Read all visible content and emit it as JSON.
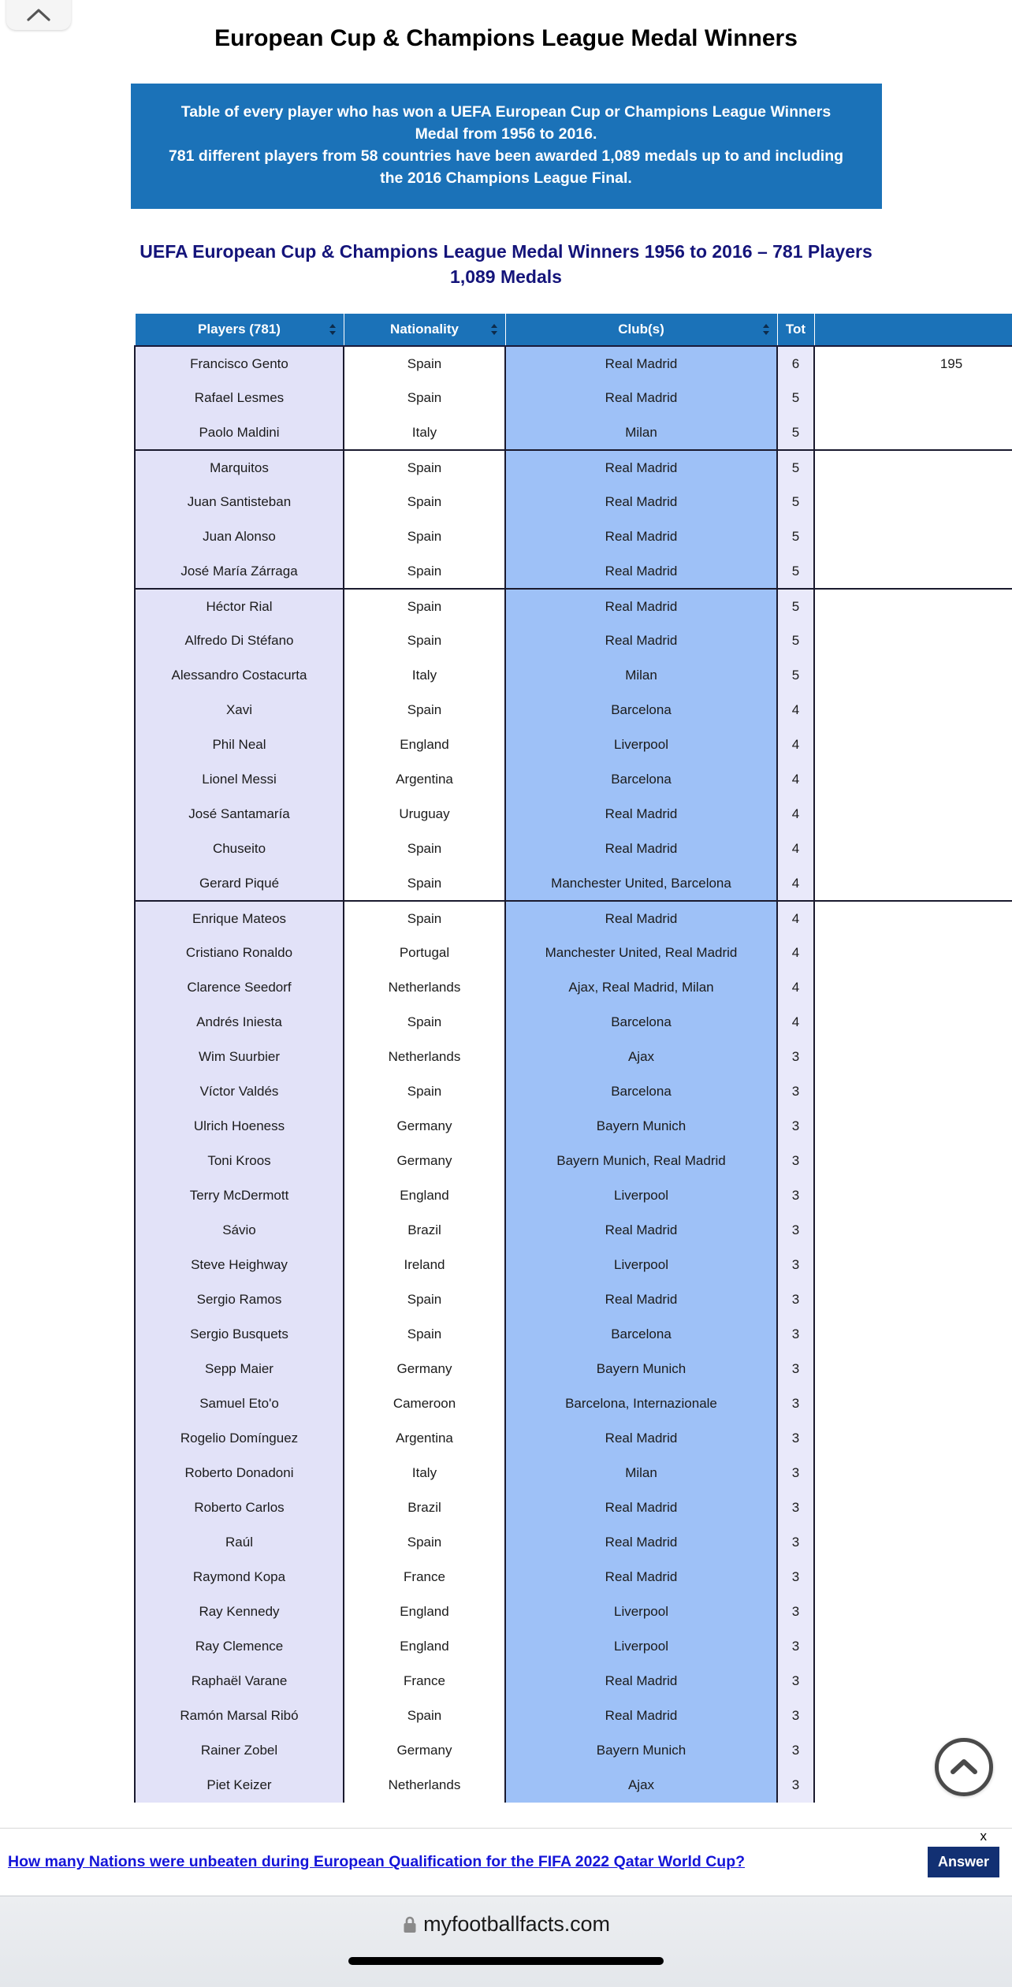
{
  "page": {
    "title": "European Cup & Champions League Medal Winners",
    "info_lines": [
      "Table of every player who has won a UEFA European Cup or Champions League Winners Medal from 1956 to 2016.",
      "781 different players from 58 countries have been awarded 1,089 medals up to and including the 2016 Champions League Final."
    ],
    "subtitle": "UEFA European Cup & Champions League Medal Winners 1956 to 2016 – 781 Players 1,089 Medals"
  },
  "top_chip": {
    "icon": "chevron-up-icon"
  },
  "scroll_top_button": {
    "icon": "circle-chevron-up-icon"
  },
  "table": {
    "columns": [
      {
        "label": "Players (781)",
        "sortable": true
      },
      {
        "label": "Nationality",
        "sortable": true
      },
      {
        "label": "Club(s)",
        "sortable": true
      },
      {
        "label": "Tot",
        "sortable": false
      },
      {
        "label": "",
        "sortable": false
      }
    ],
    "rows": [
      {
        "player": "Francisco Gento",
        "nationality": "Spain",
        "clubs": "Real Madrid",
        "tot": "6",
        "years": "195",
        "group_start": true
      },
      {
        "player": "Rafael Lesmes",
        "nationality": "Spain",
        "clubs": "Real Madrid",
        "tot": "5",
        "years": ""
      },
      {
        "player": "Paolo Maldini",
        "nationality": "Italy",
        "clubs": "Milan",
        "tot": "5",
        "years": "",
        "group_end": true
      },
      {
        "player": "Marquitos",
        "nationality": "Spain",
        "clubs": "Real Madrid",
        "tot": "5",
        "years": "",
        "group_start": true
      },
      {
        "player": "Juan Santisteban",
        "nationality": "Spain",
        "clubs": "Real Madrid",
        "tot": "5",
        "years": ""
      },
      {
        "player": "Juan Alonso",
        "nationality": "Spain",
        "clubs": "Real Madrid",
        "tot": "5",
        "years": ""
      },
      {
        "player": "José María Zárraga",
        "nationality": "Spain",
        "clubs": "Real Madrid",
        "tot": "5",
        "years": "",
        "group_end": true
      },
      {
        "player": "Héctor Rial",
        "nationality": "Spain",
        "clubs": "Real Madrid",
        "tot": "5",
        "years": "",
        "group_start": true
      },
      {
        "player": "Alfredo Di Stéfano",
        "nationality": "Spain",
        "clubs": "Real Madrid",
        "tot": "5",
        "years": ""
      },
      {
        "player": "Alessandro Costacurta",
        "nationality": "Italy",
        "clubs": "Milan",
        "tot": "5",
        "years": ""
      },
      {
        "player": "Xavi",
        "nationality": "Spain",
        "clubs": "Barcelona",
        "tot": "4",
        "years": ""
      },
      {
        "player": "Phil Neal",
        "nationality": "England",
        "clubs": "Liverpool",
        "tot": "4",
        "years": ""
      },
      {
        "player": "Lionel Messi",
        "nationality": "Argentina",
        "clubs": "Barcelona",
        "tot": "4",
        "years": ""
      },
      {
        "player": "José Santamaría",
        "nationality": "Uruguay",
        "clubs": "Real Madrid",
        "tot": "4",
        "years": ""
      },
      {
        "player": "Chuseito",
        "nationality": "Spain",
        "clubs": "Real Madrid",
        "tot": "4",
        "years": ""
      },
      {
        "player": "Gerard Piqué",
        "nationality": "Spain",
        "clubs": "Manchester United, Barcelona",
        "tot": "4",
        "years": "",
        "group_end": true
      },
      {
        "player": "Enrique Mateos",
        "nationality": "Spain",
        "clubs": "Real Madrid",
        "tot": "4",
        "years": "",
        "group_start": true
      },
      {
        "player": "Cristiano Ronaldo",
        "nationality": "Portugal",
        "clubs": "Manchester United, Real Madrid",
        "tot": "4",
        "years": ""
      },
      {
        "player": "Clarence Seedorf",
        "nationality": "Netherlands",
        "clubs": "Ajax, Real Madrid, Milan",
        "tot": "4",
        "years": ""
      },
      {
        "player": "Andrés Iniesta",
        "nationality": "Spain",
        "clubs": "Barcelona",
        "tot": "4",
        "years": ""
      },
      {
        "player": "Wim Suurbier",
        "nationality": "Netherlands",
        "clubs": "Ajax",
        "tot": "3",
        "years": ""
      },
      {
        "player": "Víctor Valdés",
        "nationality": "Spain",
        "clubs": "Barcelona",
        "tot": "3",
        "years": ""
      },
      {
        "player": "Ulrich Hoeness",
        "nationality": "Germany",
        "clubs": "Bayern Munich",
        "tot": "3",
        "years": ""
      },
      {
        "player": "Toni Kroos",
        "nationality": "Germany",
        "clubs": "Bayern Munich, Real Madrid",
        "tot": "3",
        "years": ""
      },
      {
        "player": "Terry McDermott",
        "nationality": "England",
        "clubs": "Liverpool",
        "tot": "3",
        "years": ""
      },
      {
        "player": "Sávio",
        "nationality": "Brazil",
        "clubs": "Real Madrid",
        "tot": "3",
        "years": ""
      },
      {
        "player": "Steve Heighway",
        "nationality": "Ireland",
        "clubs": "Liverpool",
        "tot": "3",
        "years": ""
      },
      {
        "player": "Sergio Ramos",
        "nationality": "Spain",
        "clubs": "Real Madrid",
        "tot": "3",
        "years": ""
      },
      {
        "player": "Sergio Busquets",
        "nationality": "Spain",
        "clubs": "Barcelona",
        "tot": "3",
        "years": ""
      },
      {
        "player": "Sepp Maier",
        "nationality": "Germany",
        "clubs": "Bayern Munich",
        "tot": "3",
        "years": ""
      },
      {
        "player": "Samuel Eto'o",
        "nationality": "Cameroon",
        "clubs": "Barcelona, Internazionale",
        "tot": "3",
        "years": ""
      },
      {
        "player": "Rogelio Domínguez",
        "nationality": "Argentina",
        "clubs": "Real Madrid",
        "tot": "3",
        "years": ""
      },
      {
        "player": "Roberto Donadoni",
        "nationality": "Italy",
        "clubs": "Milan",
        "tot": "3",
        "years": ""
      },
      {
        "player": "Roberto Carlos",
        "nationality": "Brazil",
        "clubs": "Real Madrid",
        "tot": "3",
        "years": ""
      },
      {
        "player": "Raúl",
        "nationality": "Spain",
        "clubs": "Real Madrid",
        "tot": "3",
        "years": ""
      },
      {
        "player": "Raymond Kopa",
        "nationality": "France",
        "clubs": "Real Madrid",
        "tot": "3",
        "years": ""
      },
      {
        "player": "Ray Kennedy",
        "nationality": "England",
        "clubs": "Liverpool",
        "tot": "3",
        "years": ""
      },
      {
        "player": "Ray Clemence",
        "nationality": "England",
        "clubs": "Liverpool",
        "tot": "3",
        "years": ""
      },
      {
        "player": "Raphaël Varane",
        "nationality": "France",
        "clubs": "Real Madrid",
        "tot": "3",
        "years": ""
      },
      {
        "player": "Ramón Marsal Ribó",
        "nationality": "Spain",
        "clubs": "Real Madrid",
        "tot": "3",
        "years": ""
      },
      {
        "player": "Rainer Zobel",
        "nationality": "Germany",
        "clubs": "Bayern Munich",
        "tot": "3",
        "years": ""
      },
      {
        "player": "Piet Keizer",
        "nationality": "Netherlands",
        "clubs": "Ajax",
        "tot": "3",
        "years": ""
      }
    ]
  },
  "ad_banner": {
    "question": "How many Nations were unbeaten during European Qualification for the FIFA 2022 Qatar World Cup?",
    "answer_label": "Answer",
    "close_label": "x"
  },
  "browser": {
    "url": "myfootballfacts.com",
    "lock_icon": "lock-icon"
  },
  "colors": {
    "header_blue": "#1b72b8",
    "subtitle_navy": "#14147a",
    "club_cell": "#9ec1f7",
    "player_cell": "#e2e2f8",
    "ad_link": "#1414d8",
    "answer_button": "#123073"
  }
}
